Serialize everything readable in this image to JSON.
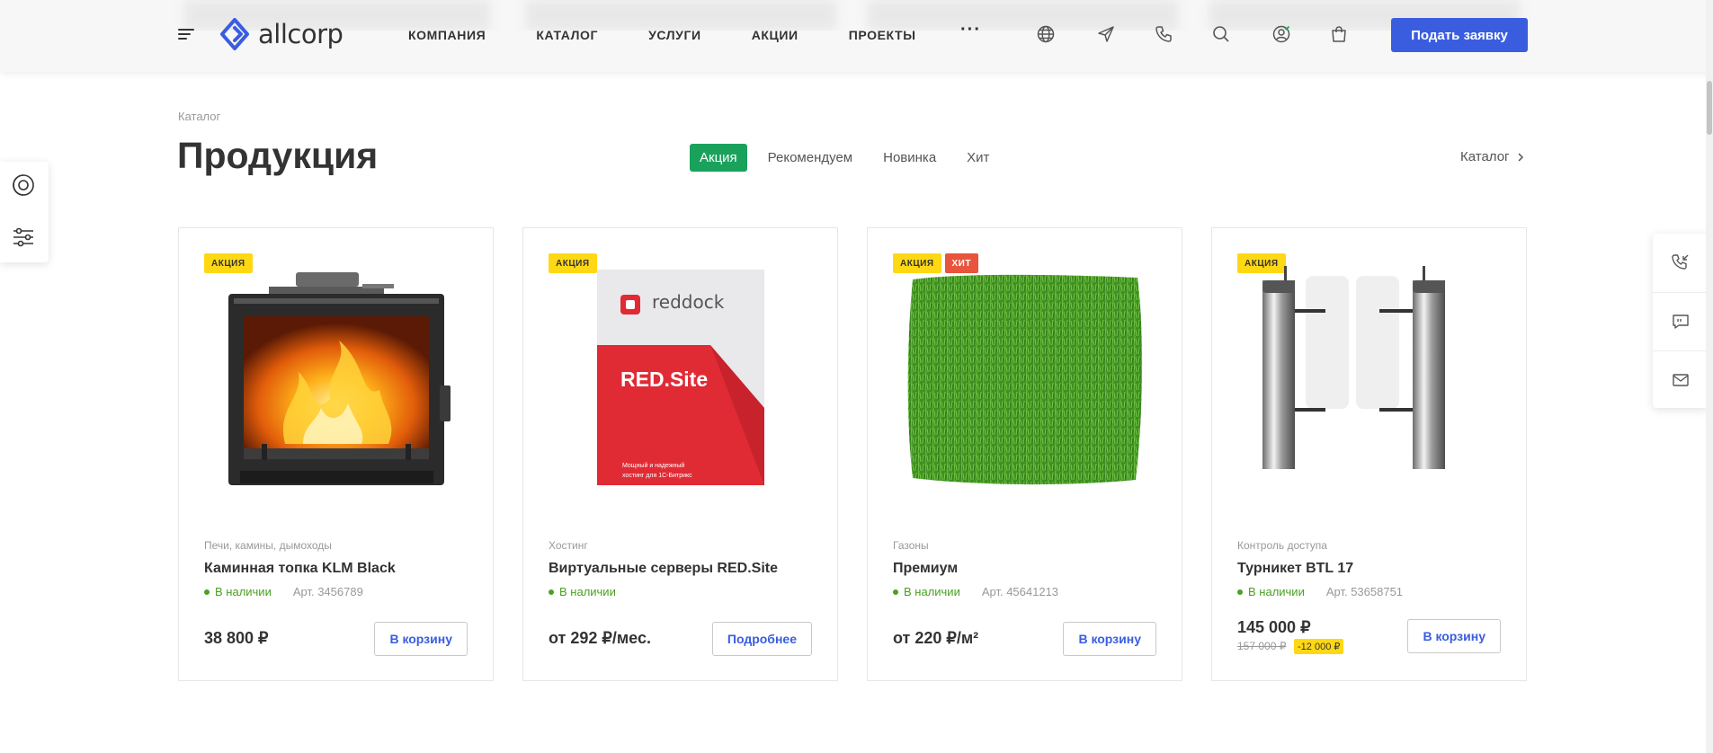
{
  "header": {
    "logo_text": "allcorp",
    "nav": [
      "КОМПАНИЯ",
      "КАТАЛОГ",
      "УСЛУГИ",
      "АКЦИИ",
      "ПРОЕКТЫ"
    ],
    "more": "···",
    "icons": [
      "globe-icon",
      "send-icon",
      "phone-icon",
      "search-icon",
      "user-icon",
      "cart-icon"
    ],
    "cta_label": "Подать заявку",
    "accent": "#3a5de0"
  },
  "section": {
    "breadcrumb": "Каталог",
    "title": "Продукция",
    "tabs": [
      {
        "label": "Акция",
        "active": true
      },
      {
        "label": "Рекомендуем",
        "active": false
      },
      {
        "label": "Новинка",
        "active": false
      },
      {
        "label": "Хит",
        "active": false
      }
    ],
    "catalog_link": "Каталог",
    "tab_active_color": "#1aa25c"
  },
  "products": [
    {
      "badges": [
        "АКЦИЯ"
      ],
      "image": "fireplace",
      "category": "Печи, камины, дымоходы",
      "name": "Каминная топка KLM Black",
      "stock": "В наличии",
      "article": "Арт. 3456789",
      "price": "38 800 ₽",
      "button": "В корзину"
    },
    {
      "badges": [
        "АКЦИЯ"
      ],
      "image": "reddock-box",
      "category": "Хостинг",
      "name": "Виртуальные серверы RED.Site",
      "stock": "В наличии",
      "article": "",
      "price": "от 292 ₽/мес.",
      "button": "Подробнее",
      "box_brand": "reddock",
      "box_title": "RED.Site",
      "box_caption_1": "Мощный и надежный",
      "box_caption_2": "хостинг для 1С-Битрикс"
    },
    {
      "badges": [
        "АКЦИЯ",
        "ХИТ"
      ],
      "image": "grass",
      "category": "Газоны",
      "name": "Премиум",
      "stock": "В наличии",
      "article": "Арт. 45641213",
      "price": "от 220 ₽/м²",
      "button": "В корзину"
    },
    {
      "badges": [
        "АКЦИЯ"
      ],
      "image": "turnstile",
      "category": "Контроль доступа",
      "name": "Турникет BTL 17",
      "stock": "В наличии",
      "article": "Арт. 53658751",
      "price": "145 000 ₽",
      "old_price": "157 000 ₽",
      "discount": "-12 000 ₽",
      "button": "В корзину"
    }
  ],
  "side_left": [
    "theme-icon",
    "filter-icon"
  ],
  "side_right": [
    "callback-icon",
    "chat-icon",
    "mail-icon"
  ]
}
